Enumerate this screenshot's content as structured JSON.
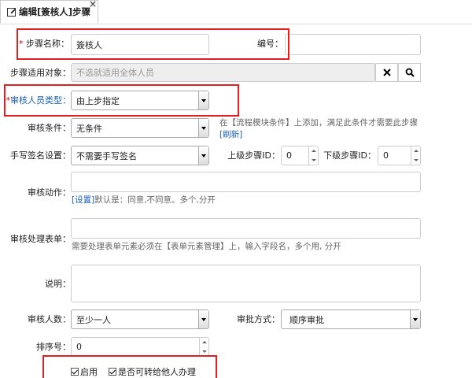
{
  "tab": {
    "title": "编辑[簽核人]步骤",
    "close": "×"
  },
  "form": {
    "step_name_label": "步骤名称：",
    "step_name_value": "簽核人",
    "number_label": "编号：",
    "number_value": "",
    "applies_to_label": "步骤适用对象：",
    "applies_to_placeholder": "不选就适用全体人员",
    "reviewer_type_label": "审核人员类型：",
    "reviewer_type_value": "由上步指定",
    "condition_label": "审核条件：",
    "condition_value": "无条件",
    "condition_hint": "在【流程模块条件】上添加，满足此条件才需要此步骤",
    "refresh_link": "[刷新]",
    "signature_label": "手写签名设置：",
    "signature_value": "不需要手写签名",
    "prev_step_label": "上级步骤ID：",
    "prev_step_value": "0",
    "next_step_label": "下级步骤ID：",
    "next_step_value": "0",
    "action_label": "审核动作：",
    "action_value": "",
    "action_settings_link": "[设置]",
    "action_hint": "默认是：同意,不同意。多个,分开",
    "form_label": "审核处理表单：",
    "form_value": "",
    "form_hint": "需要处理表单元素必须在【表单元素管理】上，输入字段名，多个用, 分开",
    "desc_label": "说明：",
    "desc_value": "",
    "count_label": "审核人数：",
    "count_value": "至少一人",
    "mode_label": "审批方式：",
    "mode_value": "顺序审批",
    "sort_label": "排序号：",
    "sort_value": "0",
    "enable_label": "启用",
    "transfer_label": "是否可转给他人办理"
  },
  "icons": {
    "clear": "close-icon",
    "search": "search-icon",
    "edit": "edit-icon"
  },
  "colors": {
    "highlight": "#e02020",
    "link": "#1a5fb4"
  }
}
